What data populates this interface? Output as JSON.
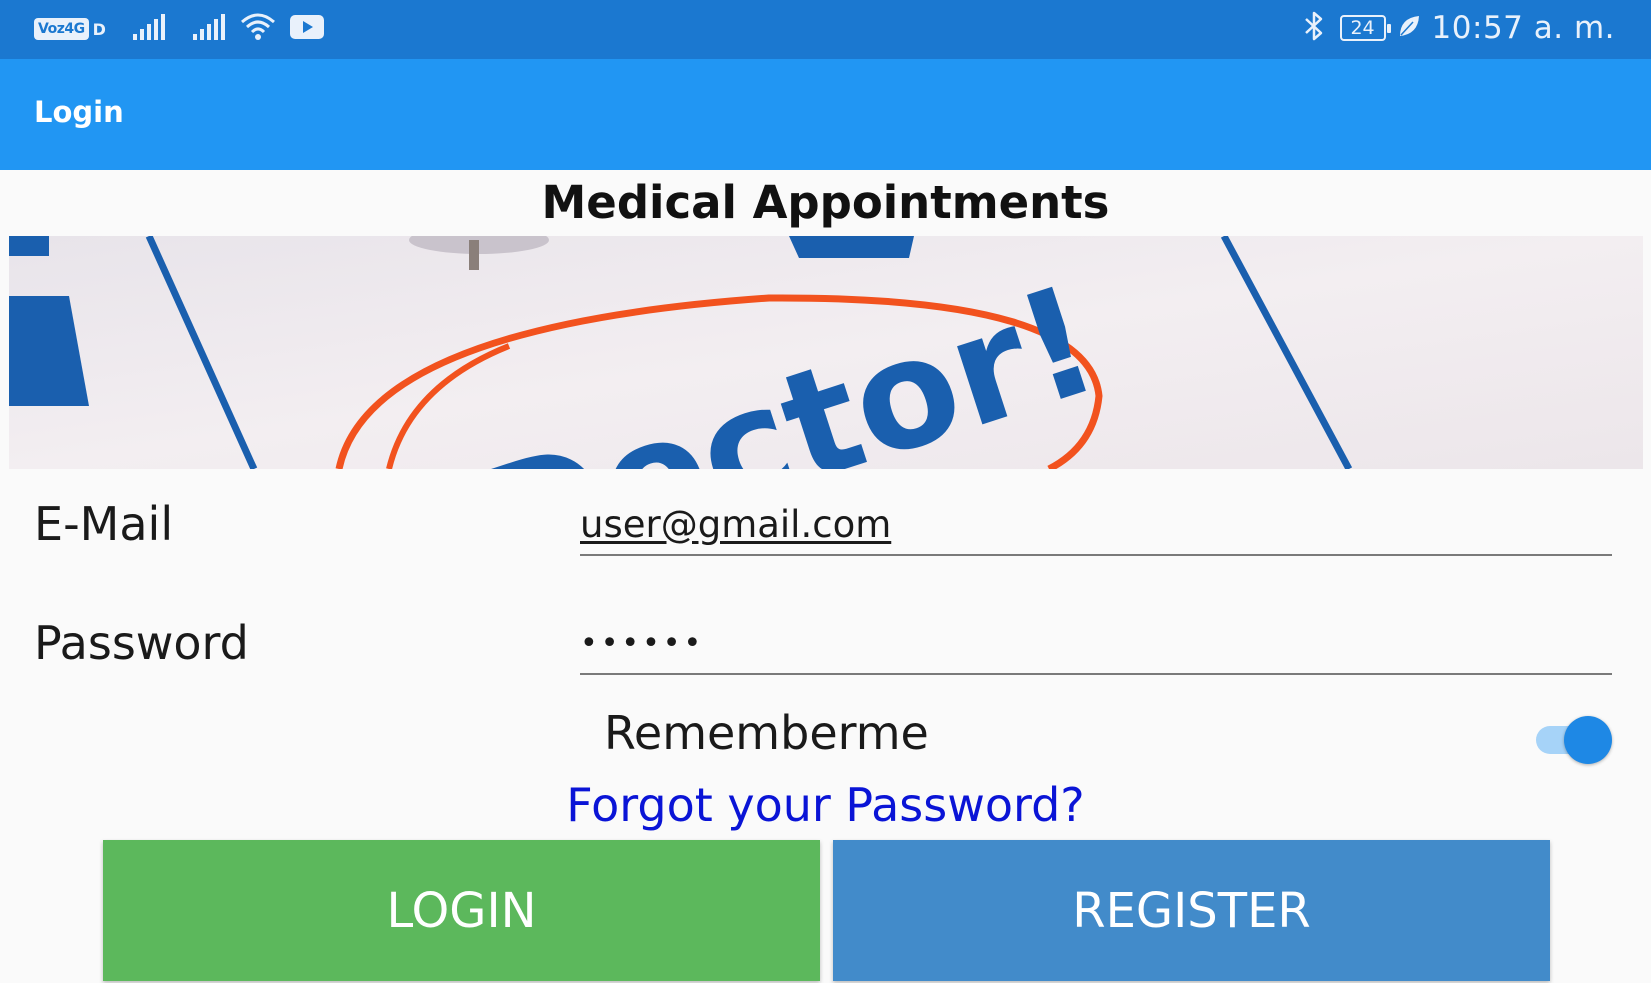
{
  "status_bar": {
    "carrier_badge": "Voz4G",
    "carrier_suffix": "D",
    "battery_level": "24",
    "time": "10:57 a. m."
  },
  "app_bar": {
    "title": "Login"
  },
  "page": {
    "title": "Medical Appointments"
  },
  "banner": {
    "text": "Doctor!"
  },
  "form": {
    "email_label": "E-Mail",
    "email_value": "user@gmail.com",
    "password_label": "Password",
    "password_value": "••••••",
    "remember_label": "Rememberme",
    "remember_on": true,
    "forgot_link": "Forgot your Password?"
  },
  "buttons": {
    "login_label": "LOGIN",
    "register_label": "REGISTER"
  },
  "colors": {
    "status_bar": "#1b78d0",
    "app_bar": "#2196f3",
    "login_button": "#5cb85c",
    "register_button": "#428bca",
    "link": "#0a14d6",
    "toggle_on": "#1e88e5"
  },
  "icons": {
    "status_left": [
      "signal-icon",
      "signal-icon",
      "wifi-icon",
      "youtube-icon"
    ],
    "status_right": [
      "bluetooth-icon",
      "battery-icon",
      "leaf-icon"
    ]
  }
}
